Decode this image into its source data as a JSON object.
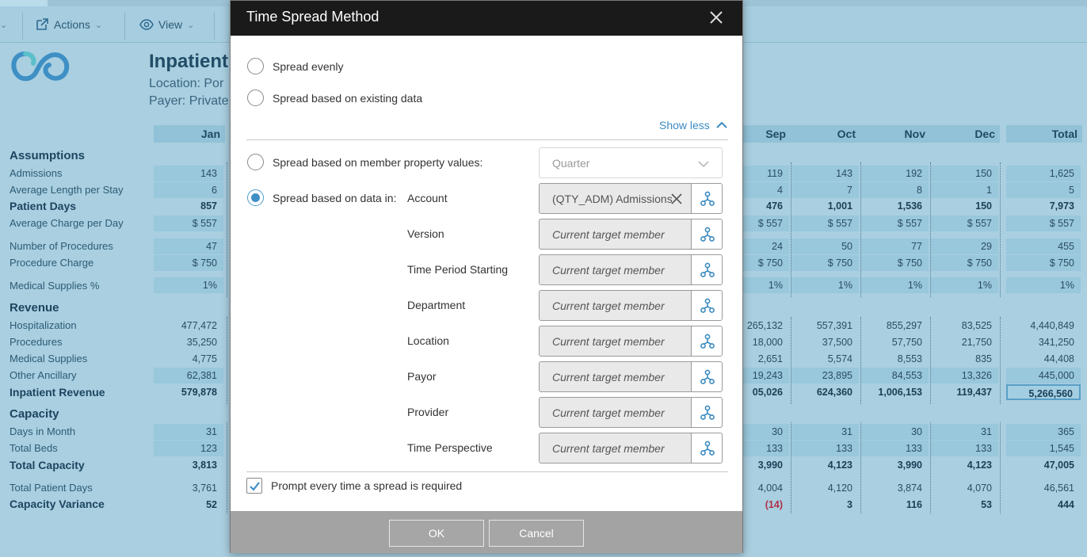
{
  "toolbar": {
    "actions_label": "Actions",
    "view_label": "View"
  },
  "report": {
    "title": "Inpatient",
    "location": "Location: Por",
    "payer": "Payer: Private"
  },
  "columns": [
    "Jan",
    "Sep",
    "Oct",
    "Nov",
    "Dec",
    "Total"
  ],
  "rows": {
    "assumptions": "Assumptions",
    "admissions": "Admissions",
    "alos": "Average Length per Stay",
    "patient_days": "Patient Days",
    "avg_charge": "Average Charge per Day",
    "num_procedures": "Number of Procedures",
    "procedure_charge": "Procedure Charge",
    "med_supplies_pct": "Medical Supplies %",
    "revenue": "Revenue",
    "hospitalization": "Hospitalization",
    "procedures": "Procedures",
    "medical_supplies": "Medical Supplies",
    "other_ancillary": "Other Ancillary",
    "inpatient_revenue": "Inpatient Revenue",
    "capacity": "Capacity",
    "days_in_month": "Days in Month",
    "total_beds": "Total Beds",
    "total_capacity": "Total Capacity",
    "total_patient_days": "Total Patient Days",
    "capacity_variance": "Capacity Variance"
  },
  "values": {
    "jan": {
      "admissions": "143",
      "alos": "6",
      "patient_days": "857",
      "avg_charge": "$ 557",
      "num_procedures": "47",
      "procedure_charge": "$ 750",
      "med_supplies_pct": "1%",
      "hospitalization": "477,472",
      "procedures": "35,250",
      "medical_supplies": "4,775",
      "other_ancillary": "62,381",
      "inpatient_revenue": "579,878",
      "days_in_month": "31",
      "total_beds": "123",
      "total_capacity": "3,813",
      "total_patient_days": "3,761",
      "capacity_variance": "52"
    },
    "sep": {
      "admissions": "119",
      "alos": "4",
      "patient_days": "476",
      "avg_charge": "$ 557",
      "num_procedures": "24",
      "procedure_charge": "$ 750",
      "med_supplies_pct": "1%",
      "hospitalization": "265,132",
      "procedures": "18,000",
      "medical_supplies": "2,651",
      "other_ancillary": "19,243",
      "inpatient_revenue": "05,026",
      "days_in_month": "30",
      "total_beds": "133",
      "total_capacity": "3,990",
      "total_patient_days": "4,004",
      "capacity_variance": "(14)"
    },
    "oct": {
      "admissions": "143",
      "alos": "7",
      "patient_days": "1,001",
      "avg_charge": "$ 557",
      "num_procedures": "50",
      "procedure_charge": "$ 750",
      "med_supplies_pct": "1%",
      "hospitalization": "557,391",
      "procedures": "37,500",
      "medical_supplies": "5,574",
      "other_ancillary": "23,895",
      "inpatient_revenue": "624,360",
      "days_in_month": "31",
      "total_beds": "133",
      "total_capacity": "4,123",
      "total_patient_days": "4,120",
      "capacity_variance": "3"
    },
    "nov": {
      "admissions": "192",
      "alos": "8",
      "patient_days": "1,536",
      "avg_charge": "$ 557",
      "num_procedures": "77",
      "procedure_charge": "$ 750",
      "med_supplies_pct": "1%",
      "hospitalization": "855,297",
      "procedures": "57,750",
      "medical_supplies": "8,553",
      "other_ancillary": "84,553",
      "inpatient_revenue": "1,006,153",
      "days_in_month": "30",
      "total_beds": "133",
      "total_capacity": "3,990",
      "total_patient_days": "3,874",
      "capacity_variance": "116"
    },
    "dec": {
      "admissions": "150",
      "alos": "1",
      "patient_days": "150",
      "avg_charge": "$ 557",
      "num_procedures": "29",
      "procedure_charge": "$ 750",
      "med_supplies_pct": "1%",
      "hospitalization": "83,525",
      "procedures": "21,750",
      "medical_supplies": "835",
      "other_ancillary": "13,326",
      "inpatient_revenue": "119,437",
      "days_in_month": "31",
      "total_beds": "133",
      "total_capacity": "4,123",
      "total_patient_days": "4,070",
      "capacity_variance": "53"
    },
    "total": {
      "admissions": "1,625",
      "alos": "5",
      "patient_days": "7,973",
      "avg_charge": "$ 557",
      "num_procedures": "455",
      "procedure_charge": "$ 750",
      "med_supplies_pct": "1%",
      "hospitalization": "4,440,849",
      "procedures": "341,250",
      "medical_supplies": "44,408",
      "other_ancillary": "445,000",
      "inpatient_revenue": "5,266,560",
      "days_in_month": "365",
      "total_beds": "1,545",
      "total_capacity": "47,005",
      "total_patient_days": "46,561",
      "capacity_variance": "444"
    }
  },
  "dialog": {
    "title": "Time Spread Method",
    "opt_evenly": "Spread evenly",
    "opt_existing": "Spread based on existing data",
    "show_less": "Show less",
    "opt_member_property": "Spread based on member property values:",
    "property_select": "Quarter",
    "opt_data_in": "Spread based on data in:",
    "dims": [
      {
        "label": "Account",
        "value": "(QTY_ADM) Admissions"
      },
      {
        "label": "Version",
        "value": "Current target member"
      },
      {
        "label": "Time Period Starting",
        "value": "Current target member"
      },
      {
        "label": "Department",
        "value": "Current target member"
      },
      {
        "label": "Location",
        "value": "Current target member"
      },
      {
        "label": "Payor",
        "value": "Current target member"
      },
      {
        "label": "Provider",
        "value": "Current target member"
      },
      {
        "label": "Time Perspective",
        "value": "Current target member"
      }
    ],
    "prompt_label": "Prompt every time a spread is required",
    "ok_label": "OK",
    "cancel_label": "Cancel"
  },
  "colors": {
    "accent": "#3f8fc7",
    "header_bg": "#1a1a1a",
    "footer_bg": "#a3a3a3",
    "negative": "#b0304a"
  }
}
